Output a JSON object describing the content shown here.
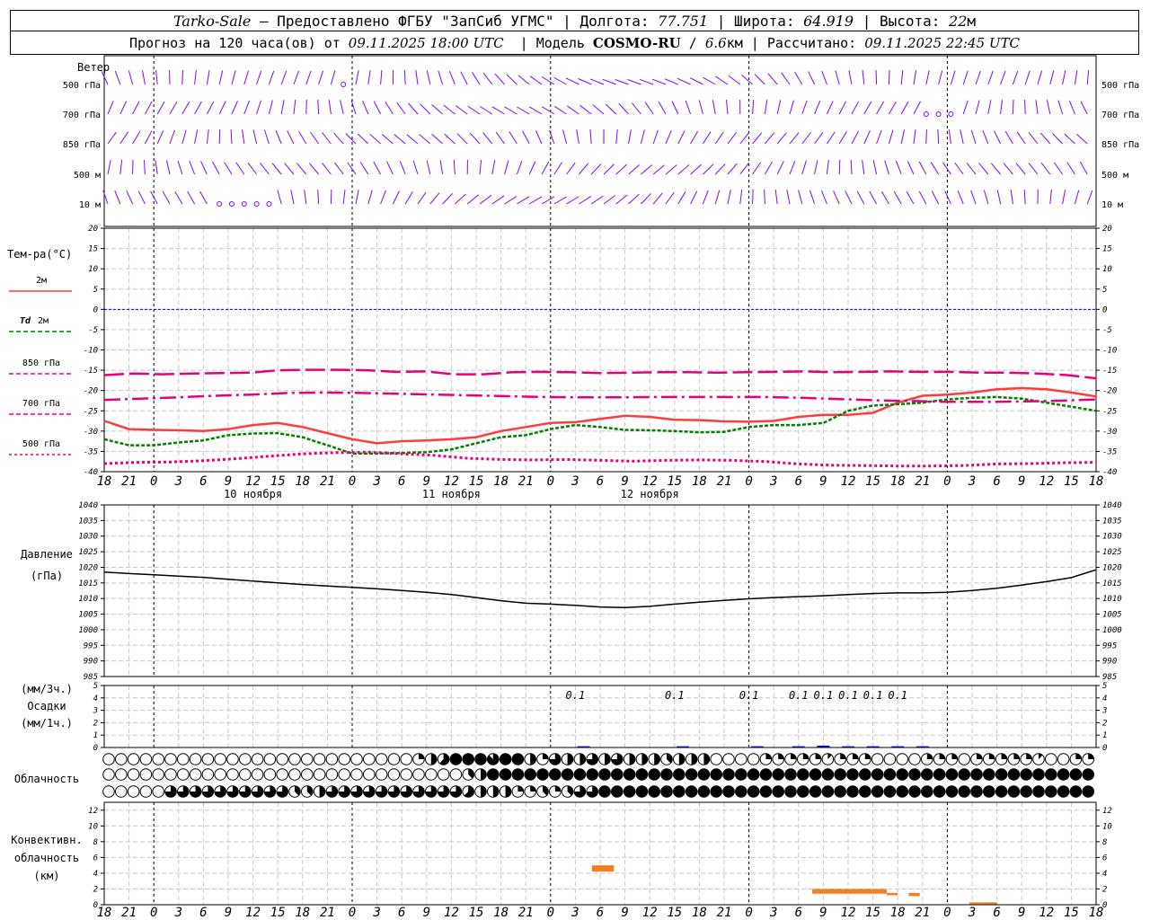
{
  "header": {
    "station": "Tarko-Sale",
    "dash": " – ",
    "provider": "Предоставлено ФГБУ \"ЗапСиб УГМС\"",
    "sep": " | ",
    "lon_label": "Долгота: ",
    "lon_value": "77.751",
    "lat_label": "Широта: ",
    "lat_value": "64.919",
    "alt_label": "Высота: ",
    "alt_value": "22",
    "alt_unit": "м",
    "forecast_prefix": "Прогноз на 120 часа(ов) от ",
    "forecast_time": "09.11.2025 18:00 UTC",
    "model_sep": "  | Модель ",
    "model_name": "COSMO-RU",
    "model_res_sep": " / ",
    "model_res": "6.6",
    "model_res_unit": "км",
    "calc_sep": " | Рассчитано: ",
    "calc_time": "09.11.2025 22:45 UTC"
  },
  "labels": {
    "wind": "Ветер",
    "wind_levels": [
      "500 гПа",
      "700 гПа",
      "850 гПа",
      "500 м",
      "10  м"
    ],
    "temp": "Тем-ра(°C)",
    "temp_2m": "2м",
    "td_prefix": "Td",
    "td_2m": "2м",
    "temp_850": "850 гПа",
    "temp_700": "700 гПа",
    "temp_500": "500 гПа",
    "pressure": "Давление",
    "pressure_unit": "(гПа)",
    "precip_3h": "(мм/3ч.)",
    "precip": "Осадки",
    "precip_1h": "(мм/1ч.)",
    "clouds": "Облачность",
    "conv1": "Конвективн.",
    "conv2": "облачность",
    "conv3": "(км)"
  },
  "colors": {
    "t2m": "#ff3c3c",
    "td2m": "#008000",
    "magenta": "#e6007e",
    "wind": "#8b00ff",
    "zero": "#0000ff",
    "precip": "#0000cc",
    "conv": "#f08020"
  },
  "chart_data": [
    {
      "type": "line",
      "panel": "temperature",
      "x_hours": [
        0,
        3,
        6,
        9,
        12,
        15,
        18,
        21,
        24,
        27,
        30,
        33,
        36,
        39,
        42,
        45,
        48,
        51,
        54,
        57,
        60,
        63,
        66,
        69,
        72,
        75,
        78,
        81,
        84,
        87,
        90,
        93,
        96,
        99,
        102,
        105,
        108,
        111,
        114,
        117,
        120
      ],
      "x_tick_labels": [
        "18",
        "21",
        "0",
        "3",
        "6",
        "9",
        "12",
        "15",
        "18",
        "21",
        "0",
        "3",
        "6",
        "9",
        "12",
        "15",
        "18",
        "21",
        "0",
        "3",
        "6",
        "9",
        "12",
        "15",
        "18",
        "21",
        "0",
        "3",
        "6",
        "9",
        "12",
        "15",
        "18",
        "21",
        "0",
        "3",
        "6",
        "9",
        "12",
        "15",
        "18",
        "21",
        "0"
      ],
      "date_labels": [
        "10 ноября",
        "11 ноября",
        "12 ноября"
      ],
      "ylim": [
        -40,
        20
      ],
      "yticks": [
        -40,
        -35,
        -30,
        -25,
        -20,
        -15,
        -10,
        -5,
        0,
        5,
        10,
        15,
        20
      ],
      "series": [
        {
          "name": "2м",
          "values": [
            -27.5,
            -29.5,
            -29.7,
            -29.8,
            -30,
            -29.5,
            -28.5,
            -28,
            -29,
            -30.5,
            -32,
            -33,
            -32.5,
            -32.3,
            -32,
            -31.5,
            -30,
            -29,
            -28,
            -27.8,
            -27,
            -26.2,
            -26.5,
            -27.2,
            -27.3,
            -27.6,
            -27.7,
            -27.5,
            -26.5,
            -26,
            -26,
            -25.5,
            -23,
            -21.3,
            -21,
            -20.5,
            -19.7,
            -19.4,
            -19.7,
            -20.5,
            -21.5
          ]
        },
        {
          "name": "Td 2м",
          "values": [
            -32,
            -33.5,
            -33.5,
            -32.8,
            -32.3,
            -31,
            -30.6,
            -30.5,
            -31.5,
            -33.5,
            -35.5,
            -35.5,
            -35.4,
            -35.2,
            -34.5,
            -33,
            -31.5,
            -31,
            -29.5,
            -28.5,
            -29,
            -29.7,
            -29.8,
            -30,
            -30.3,
            -30.2,
            -29,
            -28.5,
            -28.5,
            -28,
            -25,
            -23.7,
            -23.4,
            -23,
            -22.2,
            -21.8,
            -21.6,
            -22,
            -23,
            -24,
            -25
          ]
        },
        {
          "name": "850 гПа",
          "values": [
            -16.2,
            -15.8,
            -16,
            -15.8,
            -15.7,
            -15.6,
            -15,
            -14.9,
            -14.9,
            -15,
            -15.4,
            -15.3,
            -16,
            -16,
            -15.5,
            -15.4,
            -15.5,
            -15.7,
            -15.6,
            -15.5,
            -15.5,
            -15.6,
            -15.5,
            -15.4,
            -15.3,
            -15.5,
            -15.4,
            -15.3,
            -15.4,
            -15.4,
            -15.6,
            -15.6,
            -15.8,
            -16.2,
            -17
          ]
        },
        {
          "name": "700 гПа",
          "values": [
            -22.3,
            -22,
            -21.7,
            -21.3,
            -21,
            -20.6,
            -20.5,
            -20.6,
            -20.8,
            -21,
            -21.2,
            -21.4,
            -21.6,
            -21.7,
            -21.7,
            -21.6,
            -21.6,
            -21.6,
            -21.6,
            -21.8,
            -22.1,
            -22.4,
            -22.6,
            -22.8,
            -22.8,
            -22.7,
            -22.5,
            -22.2
          ]
        },
        {
          "name": "500 гПа",
          "values": [
            -38,
            -37.7,
            -37.6,
            -37.3,
            -36.8,
            -36.2,
            -35.6,
            -35.3,
            -35.2,
            -35.6,
            -36,
            -36.7,
            -37,
            -37.1,
            -37,
            -37.2,
            -37.4,
            -37.2,
            -37.1,
            -37.2,
            -37.5,
            -38.1,
            -38.4,
            -38.5,
            -38.6,
            -38.6,
            -38.5,
            -38.1,
            -38,
            -37.8,
            -37.7
          ]
        }
      ]
    },
    {
      "type": "line",
      "panel": "pressure",
      "x_hours": [
        0,
        3,
        6,
        9,
        12,
        15,
        18,
        21,
        24,
        27,
        30,
        33,
        36,
        39,
        42,
        45,
        48,
        51,
        54,
        57,
        60,
        63,
        66,
        69,
        72,
        75,
        78,
        81,
        84,
        87,
        90,
        93,
        96,
        99,
        102,
        105,
        108,
        111,
        114,
        117,
        120
      ],
      "ylim": [
        985,
        1040
      ],
      "yticks": [
        985,
        990,
        995,
        1000,
        1005,
        1010,
        1015,
        1020,
        1025,
        1030,
        1035,
        1040
      ],
      "series": [
        {
          "name": "",
          "values": [
            1018.5,
            1018,
            1017.6,
            1017.2,
            1016.8,
            1016.2,
            1015.6,
            1015,
            1014.5,
            1014,
            1013.6,
            1013.1,
            1012.6,
            1012,
            1011.3,
            1010.3,
            1009.3,
            1008.5,
            1008.2,
            1007.8,
            1007.3,
            1007.1,
            1007.5,
            1008.2,
            1008.8,
            1009.4,
            1009.9,
            1010.3,
            1010.6,
            1010.9,
            1011.3,
            1011.6,
            1011.8,
            1011.8,
            1012,
            1012.6,
            1013.3,
            1014.3,
            1015.4,
            1016.7,
            1019.2
          ]
        }
      ]
    },
    {
      "type": "bar",
      "panel": "precipitation",
      "ylim": [
        0,
        5
      ],
      "yticks": [
        0,
        1,
        2,
        3,
        4,
        5
      ],
      "labels": [
        {
          "hour": 75,
          "text": "0.1"
        },
        {
          "hour": 87,
          "text": "0.1"
        },
        {
          "hour": 96,
          "text": "0.1"
        },
        {
          "hour": 102,
          "text": "0.1"
        },
        {
          "hour": 105,
          "text": "0.1"
        },
        {
          "hour": 108,
          "text": "0.1"
        },
        {
          "hour": 111,
          "text": "0.1"
        },
        {
          "hour": 114,
          "text": "0.1"
        }
      ],
      "bars": [
        {
          "hour": 76,
          "value": 0.1
        },
        {
          "hour": 88,
          "value": 0.1
        },
        {
          "hour": 97,
          "value": 0.1
        },
        {
          "hour": 102,
          "value": 0.1
        },
        {
          "hour": 105,
          "value": 0.15
        },
        {
          "hour": 108,
          "value": 0.1
        },
        {
          "hour": 111,
          "value": 0.1
        },
        {
          "hour": 114,
          "value": 0.1
        },
        {
          "hour": 117,
          "value": 0.1
        }
      ]
    },
    {
      "type": "heatmap",
      "panel": "cloudiness",
      "note": "cloud cover in octas (0-8), 3 layers x 80 steps",
      "rows": [
        "0000000000000000000000000245888788426446464443444000022222122200002220222221002224321222222222122222222",
        "0000000000000000000000000000034888888888888888888888888888888888888888888888888888",
        "0000066666666663346666666666654442232366888888888888888888888888888888888888888888"
      ]
    },
    {
      "type": "bar",
      "panel": "convective",
      "ylim": [
        0,
        13
      ],
      "yticks": [
        0,
        2,
        4,
        6,
        8,
        10,
        12
      ],
      "segments": [
        {
          "h_start": 88.5,
          "h_end": 92.5,
          "base": 4.2,
          "top": 5
        },
        {
          "h_start": 128.5,
          "h_end": 142,
          "base": 1.4,
          "top": 2
        },
        {
          "h_start": 142,
          "h_end": 144,
          "base": 1.2,
          "top": 1.5
        },
        {
          "h_start": 146,
          "h_end": 148,
          "base": 1.1,
          "top": 1.5
        },
        {
          "h_start": 157,
          "h_end": 162,
          "base": 0.2,
          "top": 0.3
        }
      ]
    }
  ]
}
